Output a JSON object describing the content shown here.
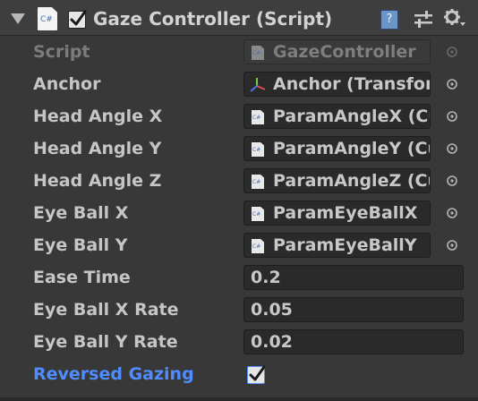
{
  "header": {
    "file_icon_text": "C#",
    "enabled": true,
    "title": "Gaze Controller (Script)",
    "help_icon_text": "?"
  },
  "fields": [
    {
      "label": "Script",
      "value": "GazeController",
      "kind": "script"
    },
    {
      "label": "Anchor",
      "value": "Anchor (Transform)",
      "kind": "transform"
    },
    {
      "label": "Head Angle X",
      "value": "ParamAngleX (CubismParameter)",
      "kind": "object"
    },
    {
      "label": "Head Angle Y",
      "value": "ParamAngleY (CubismParameter)",
      "kind": "object"
    },
    {
      "label": "Head Angle Z",
      "value": "ParamAngleZ (CubismParameter)",
      "kind": "object"
    },
    {
      "label": "Eye Ball X",
      "value": "ParamEyeBallX",
      "kind": "object"
    },
    {
      "label": "Eye Ball Y",
      "value": "ParamEyeBallY",
      "kind": "object"
    },
    {
      "label": "Ease Time",
      "value": "0.2",
      "kind": "number"
    },
    {
      "label": "Eye Ball X Rate",
      "value": "0.05",
      "kind": "number"
    },
    {
      "label": "Eye Ball Y Rate",
      "value": "0.02",
      "kind": "number"
    },
    {
      "label": "Reversed Gazing",
      "value": true,
      "kind": "toggle",
      "overridden": true
    }
  ],
  "icons": {
    "script_icon_label": "C#",
    "object_icon_label": "C#"
  },
  "colors": {
    "background": "#383838",
    "overridden_label": "#4e8cff",
    "field_background": "#2a2a2a"
  }
}
